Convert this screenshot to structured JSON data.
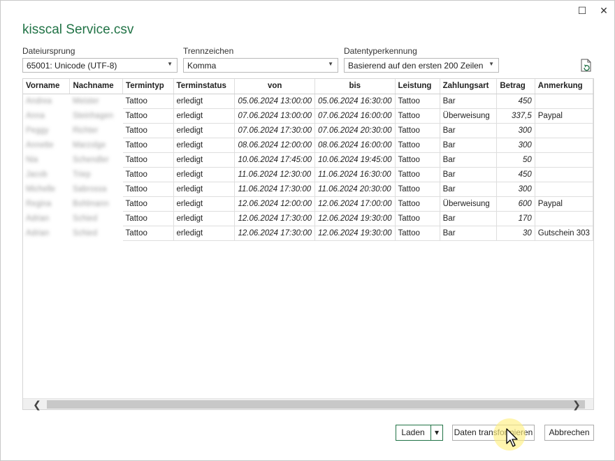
{
  "window": {
    "maximize_glyph": "☐",
    "close_glyph": "✕"
  },
  "title": "kisscal Service.csv",
  "options": {
    "origin": {
      "label": "Dateiursprung",
      "value": "65001: Unicode (UTF-8)"
    },
    "delimiter": {
      "label": "Trennzeichen",
      "value": "Komma"
    },
    "detection": {
      "label": "Datentyperkennung",
      "value": "Basierend auf den ersten 200 Zeilen"
    }
  },
  "table": {
    "columns": [
      "Vorname",
      "Nachname",
      "Termintyp",
      "Terminstatus",
      "von",
      "bis",
      "Leistung",
      "Zahlungsart",
      "Betrag",
      "Anmerkung"
    ],
    "rows": [
      [
        "Andrea",
        "Meister",
        "Tattoo",
        "erledigt",
        "05.06.2024 13:00:00",
        "05.06.2024 16:30:00",
        "Tattoo",
        "Bar",
        "450",
        ""
      ],
      [
        "Anna",
        "Steinhagen",
        "Tattoo",
        "erledigt",
        "07.06.2024 13:00:00",
        "07.06.2024 16:00:00",
        "Tattoo",
        "Überweisung",
        "337,5",
        "Paypal"
      ],
      [
        "Peggy",
        "Richter",
        "Tattoo",
        "erledigt",
        "07.06.2024 17:30:00",
        "07.06.2024 20:30:00",
        "Tattoo",
        "Bar",
        "300",
        ""
      ],
      [
        "Annette",
        "Marzolge",
        "Tattoo",
        "erledigt",
        "08.06.2024 12:00:00",
        "08.06.2024 16:00:00",
        "Tattoo",
        "Bar",
        "300",
        ""
      ],
      [
        "Nia",
        "Schendler",
        "Tattoo",
        "erledigt",
        "10.06.2024 17:45:00",
        "10.06.2024 19:45:00",
        "Tattoo",
        "Bar",
        "50",
        ""
      ],
      [
        "Jacob",
        "Triep",
        "Tattoo",
        "erledigt",
        "11.06.2024 12:30:00",
        "11.06.2024 16:30:00",
        "Tattoo",
        "Bar",
        "450",
        ""
      ],
      [
        "Michelle",
        "Sabrossa",
        "Tattoo",
        "erledigt",
        "11.06.2024 17:30:00",
        "11.06.2024 20:30:00",
        "Tattoo",
        "Bar",
        "300",
        ""
      ],
      [
        "Regina",
        "Bohlmann",
        "Tattoo",
        "erledigt",
        "12.06.2024 12:00:00",
        "12.06.2024 17:00:00",
        "Tattoo",
        "Überweisung",
        "600",
        "Paypal"
      ],
      [
        "Adrian",
        "Schied",
        "Tattoo",
        "erledigt",
        "12.06.2024 17:30:00",
        "12.06.2024 19:30:00",
        "Tattoo",
        "Bar",
        "170",
        ""
      ],
      [
        "Adrian",
        "Schied",
        "Tattoo",
        "erledigt",
        "12.06.2024 17:30:00",
        "12.06.2024 19:30:00",
        "Tattoo",
        "Bar",
        "30",
        "Gutschein 303"
      ]
    ]
  },
  "buttons": {
    "load": "Laden",
    "load_dropdown": "▾",
    "transform": "Daten transformieren",
    "cancel": "Abbrechen"
  },
  "scroll": {
    "left_glyph": "❮",
    "right_glyph": "❯"
  },
  "colors": {
    "accent": "#217346",
    "highlight": "#fff082"
  }
}
